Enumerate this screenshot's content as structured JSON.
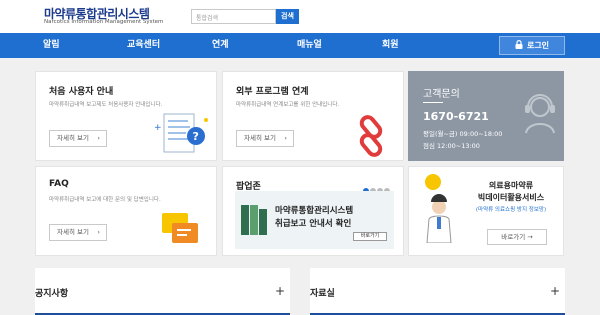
{
  "header": {
    "logo_title": "마약류통합관리시스템",
    "logo_subtitle": "Narcotics Information Management System",
    "search_placeholder": "통합검색",
    "search_button": "검색"
  },
  "nav": {
    "items": [
      "알림",
      "교육센터",
      "연계",
      "매뉴얼",
      "회원"
    ],
    "login": "로그인"
  },
  "cards": {
    "new_user": {
      "title": "처음 사용자 안내",
      "desc": "마약류취급내역 보고제도 처음사용자 안내입니다.",
      "button": "자세히 보기"
    },
    "external": {
      "title": "외부 프로그램 연계",
      "desc": "마약류취급내역 연계보고를 위한 안내입니다.",
      "button": "자세히 보기"
    },
    "faq": {
      "title": "FAQ",
      "desc": "마약류취급내역 보고에 대한 문의 및 답변입니다.",
      "button": "자세히 보기"
    },
    "popup": {
      "title": "팝업존",
      "banner_line1": "마약류통합관리시스템",
      "banner_line2": "취급보고 안내서 확인",
      "banner_button": "바로가기"
    },
    "bigdata": {
      "line1": "의료용마약류",
      "line2": "빅데이터활용서비스",
      "line3": "(마약류 의료쇼핑 방지 정보망)",
      "button": "바로가기 →"
    }
  },
  "contact": {
    "label": "고객문의",
    "phone": "1670-6721",
    "weekday": "평일(월~금) 09:00~18:00",
    "lunch": "점심 12:00~13:00"
  },
  "boards": {
    "notice": "공지사항",
    "archive": "자료실"
  },
  "colors": {
    "primary": "#1f6fd0",
    "contact_bg": "#8d97a4"
  }
}
